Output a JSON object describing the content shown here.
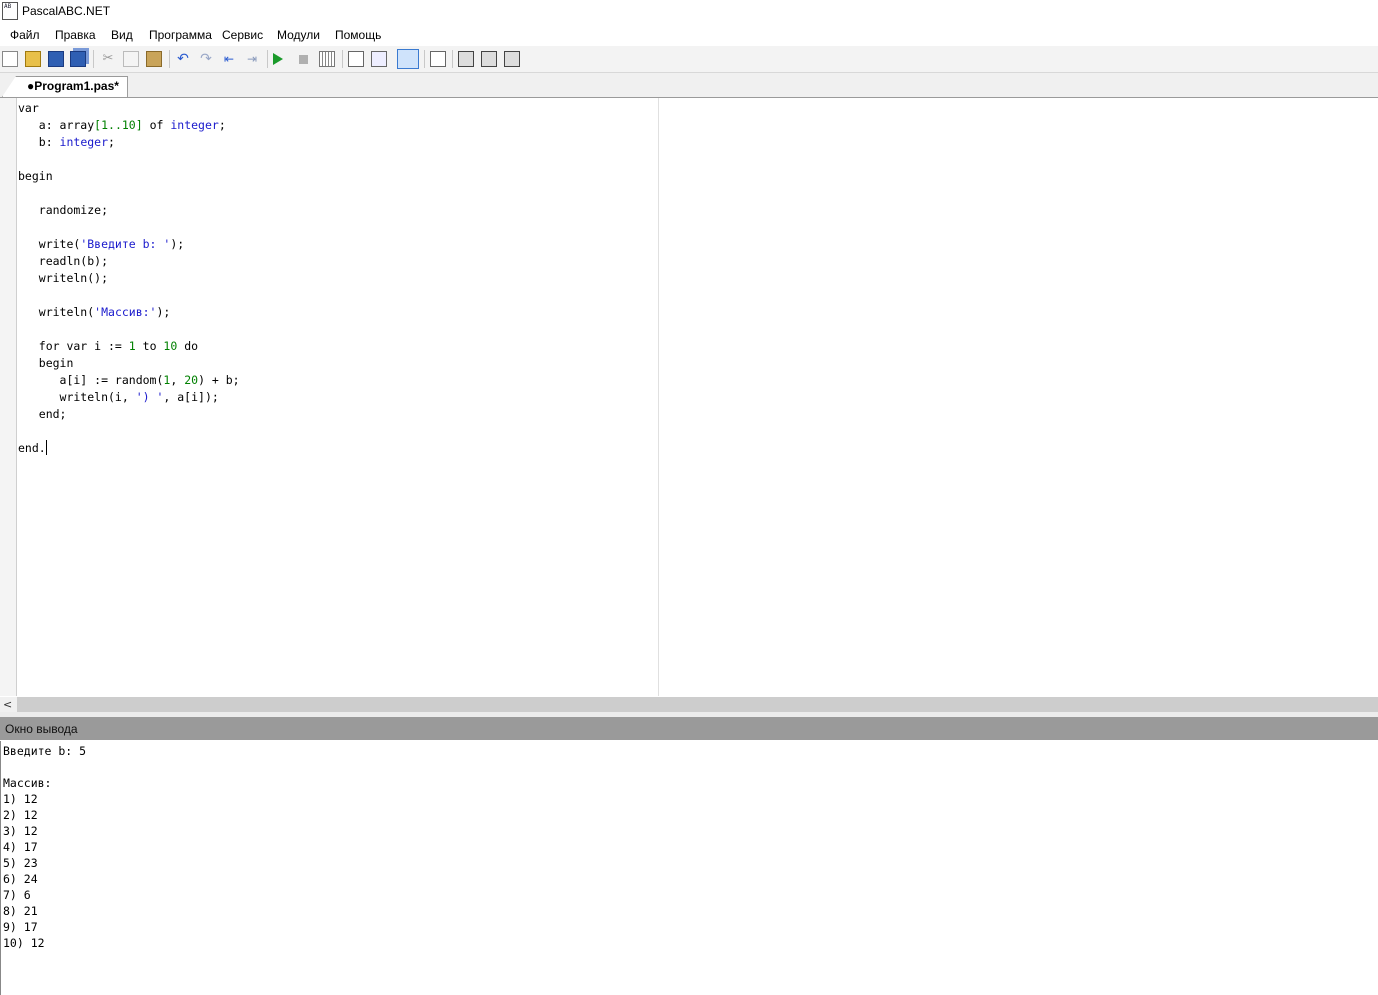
{
  "window": {
    "title": "PascalABC.NET",
    "icon": "pascalabc-app-icon",
    "icon_text": "AB"
  },
  "menu": [
    "Файл",
    "Правка",
    "Вид",
    "Программа",
    "Сервис",
    "Модули",
    "Помощь"
  ],
  "toolbar": {
    "buttons": [
      "new-file-icon",
      "open-folder-icon",
      "save-icon",
      "save-all-icon",
      "cut-icon",
      "copy-icon",
      "paste-icon",
      "undo-icon",
      "redo-icon",
      "indent-left-icon",
      "indent-right-icon",
      "run-icon",
      "stop-icon",
      "compile-icon",
      "step-into-icon",
      "step-over-icon",
      "output-window-icon",
      "reformat-icon",
      "module-1-icon",
      "module-2-icon",
      "module-3-icon"
    ]
  },
  "tabs": [
    {
      "label": "●Program1.pas*",
      "active": true
    }
  ],
  "editor": {
    "lines": {
      "l1": "var",
      "l2a": "   a: array",
      "l2b": "[1..10]",
      "l2c": " of ",
      "l2d": "integer",
      "l2e": ";",
      "l3a": "   b: ",
      "l3b": "integer",
      "l3c": ";",
      "l5": "begin",
      "l7": "   randomize;",
      "l9a": "   write(",
      "l9b": "'Введите b: '",
      "l9c": ");",
      "l10": "   readln(b);",
      "l11": "   writeln();",
      "l13a": "   writeln(",
      "l13b": "'Массив:'",
      "l13c": ");",
      "l15a": "   for var i := ",
      "l15b": "1",
      "l15c": " to ",
      "l15d": "10",
      "l15e": " do",
      "l16": "   begin",
      "l17a": "      a[i] := random(",
      "l17b": "1",
      "l17c": ", ",
      "l17d": "20",
      "l17e": ") + b;",
      "l18a": "      writeln(i, ",
      "l18b": "') '",
      "l18c": ", a[i]);",
      "l19": "   end;",
      "l21": "end."
    }
  },
  "output": {
    "title": "Окно вывода",
    "lines": [
      "Введите b: 5",
      "",
      "Массив:",
      "1) 12",
      "2) 12",
      "3) 12",
      "4) 17",
      "5) 23",
      "6) 24",
      "7) 6",
      "8) 21",
      "9) 17",
      "10) 12"
    ]
  },
  "colors": {
    "keyword": "#000000",
    "type": "#1a1acc",
    "number": "#008000",
    "string": "#1a1acc",
    "output_header": "#9a9a9a"
  }
}
